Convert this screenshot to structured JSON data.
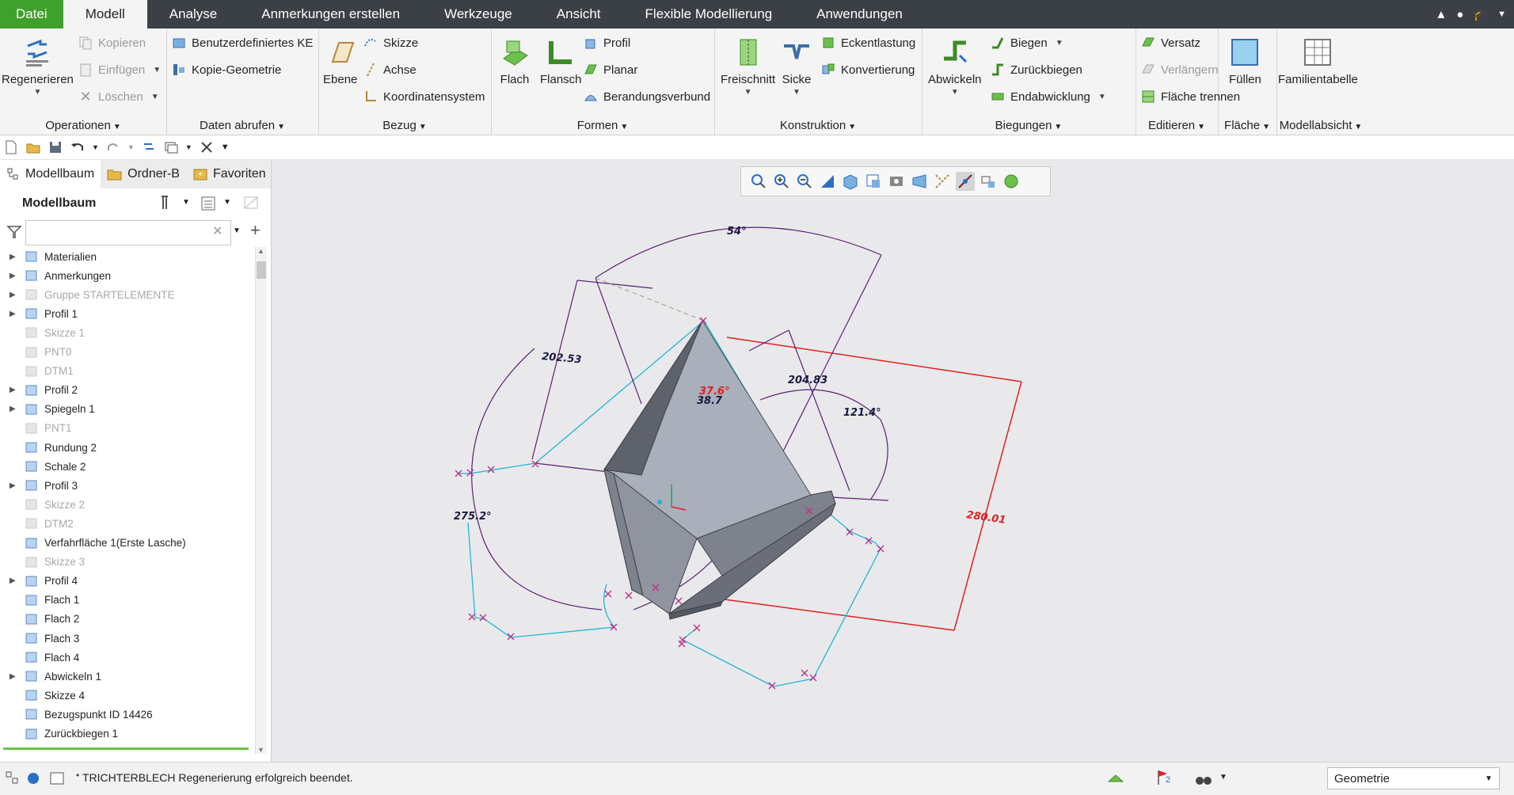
{
  "menubar": {
    "tabs": [
      "Datei",
      "Modell",
      "Analyse",
      "Anmerkungen erstellen",
      "Werkzeuge",
      "Ansicht",
      "Flexible Modellierung",
      "Anwendungen"
    ],
    "active_index": 1
  },
  "ribbon": {
    "operationen": {
      "label": "Operationen",
      "regenerieren": "Regenerieren",
      "kopieren": "Kopieren",
      "einfuegen": "Einfügen",
      "loeschen": "Löschen"
    },
    "daten": {
      "label": "Daten abrufen",
      "benutzer_ke": "Benutzerdefiniertes KE",
      "kopie_geometrie": "Kopie-Geometrie"
    },
    "bezug": {
      "label": "Bezug",
      "ebene": "Ebene",
      "skizze": "Skizze",
      "achse": "Achse",
      "koordinatensystem": "Koordinatensystem"
    },
    "formen": {
      "label": "Formen",
      "flach": "Flach",
      "flansch": "Flansch",
      "profil": "Profil",
      "planar": "Planar",
      "berandungsverbund": "Berandungsverbund"
    },
    "konstruktion": {
      "label": "Konstruktion",
      "freischnitt": "Freischnitt",
      "sicke": "Sicke",
      "eckentlastung": "Eckentlastung",
      "konvertierung": "Konvertierung"
    },
    "biegungen": {
      "label": "Biegungen",
      "abwickeln": "Abwickeln",
      "biegen": "Biegen",
      "zurueckbiegen": "Zurückbiegen",
      "endabwicklung": "Endabwicklung"
    },
    "editieren": {
      "label": "Editieren",
      "versatz": "Versatz",
      "verlaengern": "Verlängern",
      "flaeche_trennen": "Fläche trennen"
    },
    "flaeche": {
      "label": "Fläche",
      "fuellen": "Füllen"
    },
    "modellabsicht": {
      "label": "Modellabsicht",
      "familientabelle": "Familientabelle"
    }
  },
  "panel": {
    "tabs": [
      "Modellbaum",
      "Ordner-B",
      "Favoriten"
    ],
    "title": "Modellbaum",
    "search_value": "",
    "tree": [
      {
        "label": "Materialien",
        "expandable": true,
        "dim": false
      },
      {
        "label": "Anmerkungen",
        "expandable": true,
        "dim": false
      },
      {
        "label": "Gruppe STARTELEMENTE",
        "expandable": true,
        "dim": true
      },
      {
        "label": "Profil 1",
        "expandable": true,
        "dim": false
      },
      {
        "label": "Skizze 1",
        "expandable": false,
        "dim": true
      },
      {
        "label": "PNT0",
        "expandable": false,
        "dim": true
      },
      {
        "label": "DTM1",
        "expandable": false,
        "dim": true
      },
      {
        "label": "Profil 2",
        "expandable": true,
        "dim": false
      },
      {
        "label": "Spiegeln 1",
        "expandable": true,
        "dim": false
      },
      {
        "label": "PNT1",
        "expandable": false,
        "dim": true
      },
      {
        "label": "Rundung 2",
        "expandable": false,
        "dim": false
      },
      {
        "label": "Schale 2",
        "expandable": false,
        "dim": false
      },
      {
        "label": "Profil 3",
        "expandable": true,
        "dim": false
      },
      {
        "label": "Skizze 2",
        "expandable": false,
        "dim": true
      },
      {
        "label": "DTM2",
        "expandable": false,
        "dim": true
      },
      {
        "label": "Verfahrfläche 1(Erste Lasche)",
        "expandable": false,
        "dim": false
      },
      {
        "label": "Skizze 3",
        "expandable": false,
        "dim": true
      },
      {
        "label": "Profil 4",
        "expandable": true,
        "dim": false
      },
      {
        "label": "Flach 1",
        "expandable": false,
        "dim": false
      },
      {
        "label": "Flach 2",
        "expandable": false,
        "dim": false
      },
      {
        "label": "Flach 3",
        "expandable": false,
        "dim": false
      },
      {
        "label": "Flach 4",
        "expandable": false,
        "dim": false
      },
      {
        "label": "Abwickeln 1",
        "expandable": true,
        "dim": false
      },
      {
        "label": "Skizze 4",
        "expandable": false,
        "dim": false
      },
      {
        "label": "Bezugspunkt ID 14426",
        "expandable": false,
        "dim": false
      },
      {
        "label": "Zurückbiegen 1",
        "expandable": false,
        "dim": false
      }
    ]
  },
  "viewport": {
    "dimensions": {
      "angle_top": "54°",
      "dim_202": "202.53",
      "dim_204": "204.83",
      "angle_121": "121.4°",
      "angle_275": "275.2°",
      "angle_37": "37.6°",
      "angle_38": "38.7",
      "dim_280": "280.01"
    }
  },
  "statusbar": {
    "message": "TRICHTERBLECH Regenerierung erfolgreich beendet.",
    "filter_value": "Geometrie",
    "flag_count": "2"
  }
}
